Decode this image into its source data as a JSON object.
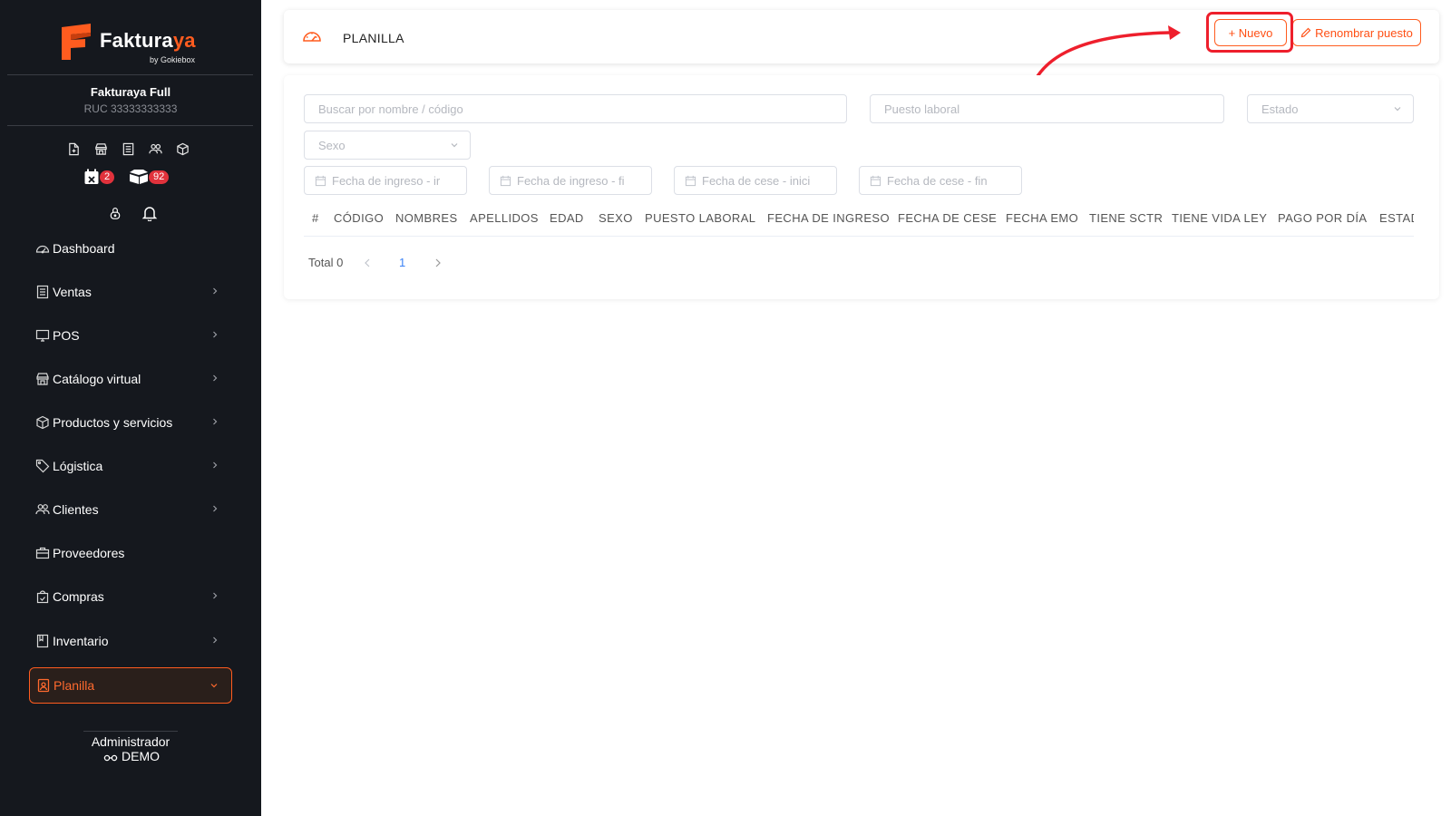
{
  "brand": {
    "name_prefix": "Faktura",
    "name_suffix": "ya",
    "tagline": "by Gokiebox",
    "color": "#ff5c1f"
  },
  "company": {
    "name": "Fakturaya Full",
    "ruc": "RUC 33333333333"
  },
  "quick_icons": [
    "new-document-icon",
    "store-icon",
    "receipt-icon",
    "users-icon",
    "box-icon"
  ],
  "badges": {
    "calendar_count": "2",
    "packages_count": "92"
  },
  "nav": {
    "items": [
      {
        "label": "Dashboard",
        "icon": "dashboard-icon",
        "expandable": false
      },
      {
        "label": "Ventas",
        "icon": "receipt-icon",
        "expandable": true
      },
      {
        "label": "POS",
        "icon": "monitor-icon",
        "expandable": true
      },
      {
        "label": "Catálogo virtual",
        "icon": "store-icon",
        "expandable": true
      },
      {
        "label": "Productos y servicios",
        "icon": "box-icon",
        "expandable": true
      },
      {
        "label": "Lógistica",
        "icon": "tag-icon",
        "expandable": true
      },
      {
        "label": "Clientes",
        "icon": "users-icon",
        "expandable": true
      },
      {
        "label": "Proveedores",
        "icon": "briefcase-icon",
        "expandable": false
      },
      {
        "label": "Compras",
        "icon": "bag-icon",
        "expandable": true
      },
      {
        "label": "Inventario",
        "icon": "book-icon",
        "expandable": true
      },
      {
        "label": "Planilla",
        "icon": "person-badge-icon",
        "expandable": true,
        "active": true
      }
    ]
  },
  "user": {
    "role": "Administrador",
    "name": "DEMO"
  },
  "header": {
    "title": "PLANILLA",
    "new_button": "+ Nuevo",
    "rename_button": "Renombrar puesto"
  },
  "filters": {
    "search_placeholder": "Buscar por nombre / código",
    "job_placeholder": "Puesto laboral",
    "status_placeholder": "Estado",
    "sex_placeholder": "Sexo",
    "hire_start": "Fecha de ingreso - ir",
    "hire_end": "Fecha de ingreso - fi",
    "cease_start": "Fecha de cese - inici",
    "cease_end": "Fecha de cese - fin"
  },
  "table": {
    "columns": [
      "#",
      "CÓDIGO",
      "NOMBRES",
      "APELLIDOS",
      "EDAD",
      "SEXO",
      "PUESTO LABORAL",
      "FECHA DE INGRESO",
      "FECHA DE CESE",
      "FECHA EMO",
      "TIENE SCTR",
      "TIENE VIDA LEY",
      "PAGO POR DÍA",
      "ESTAD"
    ],
    "rows": []
  },
  "pagination": {
    "total_label": "Total 0",
    "current_page": "1"
  },
  "colors": {
    "accent": "#ff5c1f",
    "highlight": "#ee1f2c",
    "sidebar_bg": "#15181e",
    "badge": "#e0323c",
    "link": "#3b82f6"
  }
}
